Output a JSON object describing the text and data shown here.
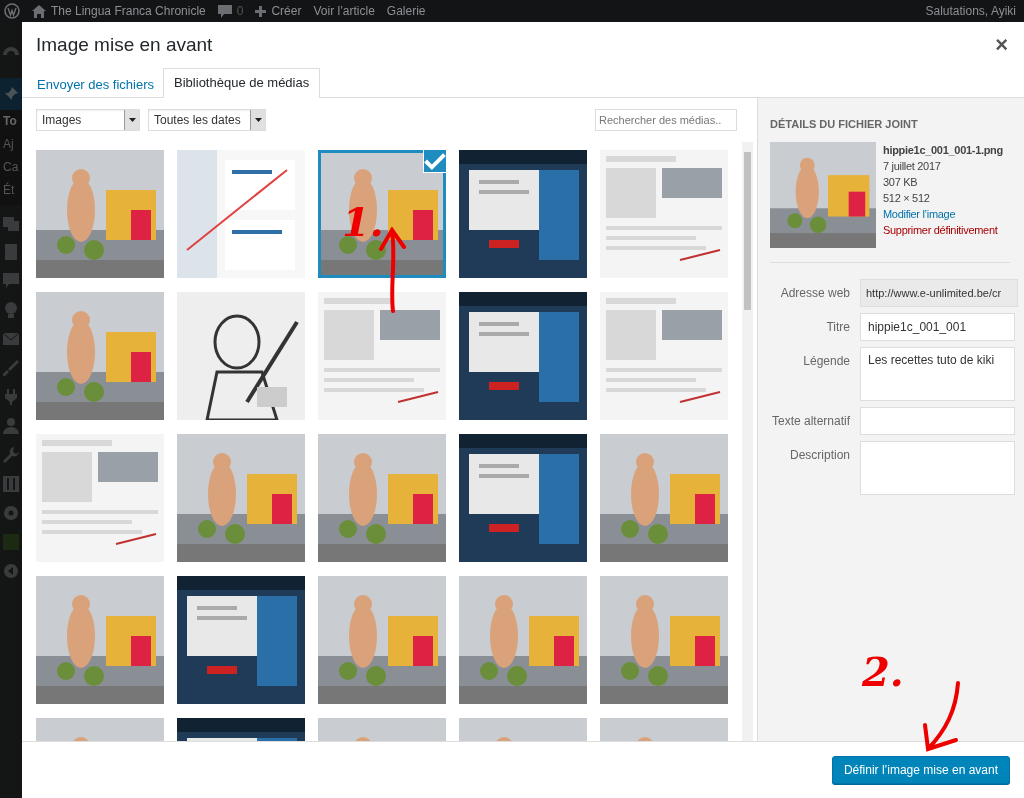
{
  "admin_bar": {
    "site": "The Lingua Franca Chronicle",
    "comments": "0",
    "items": [
      "Créer",
      "Voir l’article",
      "Galerie"
    ],
    "greeting": "Salutations, Ayiki"
  },
  "admin_menu": {
    "items": [
      "To",
      "Aj",
      "Ca",
      "Ét"
    ]
  },
  "modal": {
    "title": "Image mise en avant",
    "close": "×",
    "tabs": [
      {
        "label": "Envoyer des fichiers",
        "selected": false
      },
      {
        "label": "Bibliothèque de médias",
        "selected": true
      }
    ],
    "filters": [
      {
        "value": "Images"
      },
      {
        "value": "Toutes les dates"
      }
    ],
    "search": {
      "placeholder": "Rechercher des médias.."
    },
    "attachments": [
      {
        "selected": false
      },
      {
        "selected": false
      },
      {
        "selected": true
      },
      {
        "selected": false
      },
      {
        "selected": false
      },
      {
        "selected": false
      },
      {
        "selected": false
      },
      {
        "selected": false
      },
      {
        "selected": false
      },
      {
        "selected": false
      },
      {
        "selected": false
      },
      {
        "selected": false
      },
      {
        "selected": false
      },
      {
        "selected": false
      },
      {
        "selected": false
      },
      {
        "selected": false
      },
      {
        "selected": false
      },
      {
        "selected": false
      },
      {
        "selected": false
      },
      {
        "selected": false
      },
      {
        "selected": false
      },
      {
        "selected": false
      },
      {
        "selected": false
      },
      {
        "selected": false
      },
      {
        "selected": false
      }
    ],
    "details": {
      "heading": "DÉTAILS DU FICHIER JOINT",
      "filename": "hippie1c_001_001-1.png",
      "date": "7 juillet 2017",
      "size": "307 KB",
      "dimensions": "512 × 512",
      "edit_link": "Modifier l’image",
      "delete_link": "Supprimer définitivement",
      "fields": [
        {
          "label": "Adresse web",
          "value": "http://www.e-unlimited.be/cr",
          "kind": "readonly"
        },
        {
          "label": "Titre",
          "value": "hippie1c_001_001",
          "kind": "input"
        },
        {
          "label": "Légende",
          "value": "Les recettes tuto de kiki",
          "kind": "textarea"
        },
        {
          "label": "Texte alternatif",
          "kind": "input"
        },
        {
          "label": "Description",
          "kind": "textarea"
        }
      ]
    },
    "primary_button": "Définir l’image mise en avant",
    "annotations": [
      {
        "label": "1."
      },
      {
        "label": "2."
      }
    ]
  }
}
